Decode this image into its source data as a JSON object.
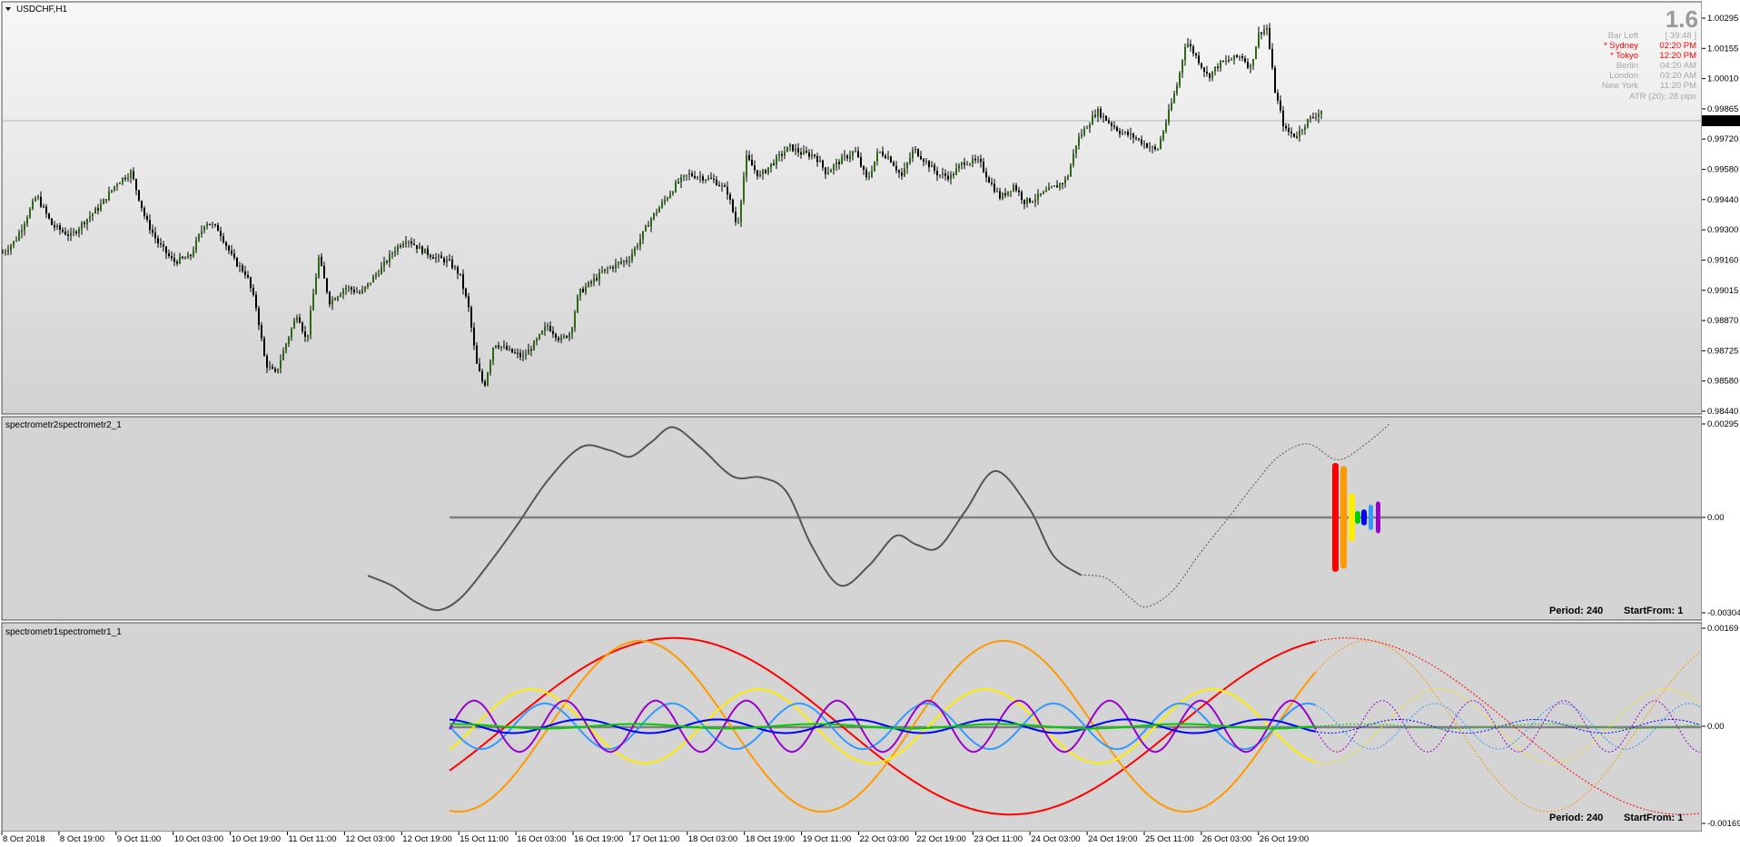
{
  "main_title": "USDCHF,H1",
  "spread_value": "1.6",
  "info_rows": [
    {
      "label": "Bar Left",
      "value": "[ 39:48 ]",
      "color": "#a6a6a6"
    },
    {
      "label": "* Sydney",
      "value": "02:20 PM",
      "color": "#ff0000"
    },
    {
      "label": "* Tokyo",
      "value": "12:20 PM",
      "color": "#ff0000"
    },
    {
      "label": "Berlin",
      "value": "04:20 AM",
      "color": "#a6a6a6"
    },
    {
      "label": "London",
      "value": "03:20 AM",
      "color": "#a6a6a6"
    },
    {
      "label": "New York",
      "value": "11:20 PM",
      "color": "#a6a6a6"
    }
  ],
  "atr_text": "ATR (20): 28 pips",
  "current_price": "0.99805",
  "price_axis_labels": [
    "1.00295",
    "1.00155",
    "1.00010",
    "0.99865",
    "0.99720",
    "0.99580",
    "0.99440",
    "0.99300",
    "0.99160",
    "0.99015",
    "0.98870",
    "0.98725",
    "0.98580",
    "0.98440"
  ],
  "sub1_title": "spectrometr2spectrometr2_1",
  "sub1_axis": [
    "0.00295",
    "0.00",
    "-0.00304"
  ],
  "sub1_footer": {
    "period": "Period: 240",
    "start": "StartFrom: 1"
  },
  "sub2_title": "spectrometr1spectrometr1_1",
  "sub2_axis": [
    "0.00169",
    "0.00",
    "-0.00169"
  ],
  "sub2_footer": {
    "period": "Period: 240",
    "start": "StartFrom: 1"
  },
  "time_labels": [
    "8 Oct 2018",
    "8 Oct 19:00",
    "9 Oct 11:00",
    "10 Oct 03:00",
    "10 Oct 19:00",
    "11 Oct 11:00",
    "12 Oct 03:00",
    "12 Oct 19:00",
    "15 Oct 11:00",
    "16 Oct 03:00",
    "16 Oct 19:00",
    "17 Oct 11:00",
    "18 Oct 03:00",
    "18 Oct 19:00",
    "19 Oct 11:00",
    "22 Oct 03:00",
    "22 Oct 19:00",
    "23 Oct 11:00",
    "24 Oct 03:00",
    "24 Oct 19:00",
    "25 Oct 11:00",
    "26 Oct 03:00",
    "26 Oct 19:00"
  ],
  "colors": {
    "bg_top": "#f7f7f7",
    "bg_bottom": "#d4d4d4",
    "candle_up": "#2a6b12",
    "candle_down": "#000000",
    "spectrum_line": "#555555",
    "zero_line": "#808080"
  },
  "chart_data": [
    {
      "type": "candlestick",
      "title": "USDCHF,H1",
      "ylim": [
        0.9844,
        1.0032
      ],
      "current": 0.99805,
      "close_path": [
        [
          0,
          0.9917
        ],
        [
          14,
          0.9924
        ],
        [
          33,
          0.9945
        ],
        [
          47,
          0.9931
        ],
        [
          64,
          0.9926
        ],
        [
          76,
          0.9933
        ],
        [
          90,
          0.994
        ],
        [
          105,
          0.9951
        ],
        [
          118,
          0.9956
        ],
        [
          131,
          0.9934
        ],
        [
          142,
          0.9923
        ],
        [
          156,
          0.9914
        ],
        [
          171,
          0.9916
        ],
        [
          185,
          0.9933
        ],
        [
          197,
          0.9929
        ],
        [
          210,
          0.9915
        ],
        [
          222,
          0.9908
        ],
        [
          231,
          0.9892
        ],
        [
          239,
          0.9866
        ],
        [
          248,
          0.9861
        ],
        [
          258,
          0.9876
        ],
        [
          268,
          0.989
        ],
        [
          276,
          0.9876
        ],
        [
          287,
          0.9916
        ],
        [
          297,
          0.9895
        ],
        [
          311,
          0.9902
        ],
        [
          325,
          0.9899
        ],
        [
          334,
          0.9905
        ],
        [
          345,
          0.9912
        ],
        [
          356,
          0.992
        ],
        [
          366,
          0.9925
        ],
        [
          378,
          0.992
        ],
        [
          392,
          0.9916
        ],
        [
          404,
          0.9914
        ],
        [
          414,
          0.9908
        ],
        [
          422,
          0.9892
        ],
        [
          429,
          0.9866
        ],
        [
          436,
          0.9855
        ],
        [
          445,
          0.9876
        ],
        [
          458,
          0.9872
        ],
        [
          471,
          0.9869
        ],
        [
          481,
          0.9875
        ],
        [
          493,
          0.9884
        ],
        [
          505,
          0.9877
        ],
        [
          514,
          0.9881
        ],
        [
          521,
          0.9899
        ],
        [
          534,
          0.9905
        ],
        [
          545,
          0.991
        ],
        [
          556,
          0.9913
        ],
        [
          566,
          0.9915
        ],
        [
          577,
          0.9925
        ],
        [
          586,
          0.9934
        ],
        [
          600,
          0.9944
        ],
        [
          610,
          0.9951
        ],
        [
          620,
          0.9955
        ],
        [
          631,
          0.9954
        ],
        [
          644,
          0.9952
        ],
        [
          655,
          0.9947
        ],
        [
          664,
          0.993
        ],
        [
          672,
          0.9963
        ],
        [
          684,
          0.9954
        ],
        [
          695,
          0.996
        ],
        [
          711,
          0.9968
        ],
        [
          722,
          0.9965
        ],
        [
          734,
          0.9964
        ],
        [
          744,
          0.9956
        ],
        [
          758,
          0.9962
        ],
        [
          770,
          0.9966
        ],
        [
          781,
          0.9952
        ],
        [
          791,
          0.9966
        ],
        [
          801,
          0.9963
        ],
        [
          812,
          0.9954
        ],
        [
          823,
          0.9967
        ],
        [
          834,
          0.9961
        ],
        [
          845,
          0.9955
        ],
        [
          856,
          0.9954
        ],
        [
          868,
          0.9961
        ],
        [
          882,
          0.9961
        ],
        [
          891,
          0.9952
        ],
        [
          901,
          0.9944
        ],
        [
          913,
          0.995
        ],
        [
          923,
          0.9942
        ],
        [
          933,
          0.9944
        ],
        [
          943,
          0.9947
        ],
        [
          953,
          0.995
        ],
        [
          961,
          0.9953
        ],
        [
          970,
          0.9971
        ],
        [
          979,
          0.9978
        ],
        [
          988,
          0.9985
        ],
        [
          998,
          0.998
        ],
        [
          1009,
          0.9975
        ],
        [
          1020,
          0.9973
        ],
        [
          1032,
          0.9969
        ],
        [
          1042,
          0.9966
        ],
        [
          1052,
          0.9983
        ],
        [
          1061,
          0.9999
        ],
        [
          1068,
          1.0018
        ],
        [
          1078,
          1.001
        ],
        [
          1088,
          1.0001
        ],
        [
          1098,
          1.0007
        ],
        [
          1108,
          1.0009
        ],
        [
          1118,
          1.0011
        ],
        [
          1126,
          1.0005
        ],
        [
          1134,
          1.0022
        ],
        [
          1141,
          1.0024
        ],
        [
          1148,
          0.9995
        ],
        [
          1157,
          0.9976
        ],
        [
          1167,
          0.9973
        ],
        [
          1177,
          0.998
        ],
        [
          1190,
          0.9985
        ]
      ]
    },
    {
      "type": "line",
      "title": "spectrometr2spectrometr2_1",
      "ylim": [
        -0.00304,
        0.00295
      ],
      "zero": 0.0,
      "series": [
        {
          "values": [
            [
              405,
              -0.00182
            ],
            [
              432,
              -0.00214
            ],
            [
              458,
              -0.00265
            ],
            [
              483,
              -0.0029
            ],
            [
              508,
              -0.0025
            ],
            [
              537,
              -0.0015
            ],
            [
              568,
              -0.0003
            ],
            [
              603,
              0.00115
            ],
            [
              640,
              0.0022
            ],
            [
              671,
              0.0021
            ],
            [
              694,
              0.0019
            ],
            [
              717,
              0.00235
            ],
            [
              741,
              0.00282
            ],
            [
              771,
              0.0022
            ],
            [
              807,
              0.00128
            ],
            [
              838,
              0.00125
            ],
            [
              866,
              0.0008
            ],
            [
              894,
              -0.0009
            ],
            [
              925,
              -0.00213
            ],
            [
              957,
              -0.0015
            ],
            [
              986,
              -0.00058
            ],
            [
              1009,
              -0.00085
            ],
            [
              1033,
              -0.00095
            ],
            [
              1063,
              0.0002
            ],
            [
              1096,
              0.00145
            ],
            [
              1133,
              0.0003
            ],
            [
              1160,
              -0.0012
            ],
            [
              1190,
              -0.0018
            ]
          ]
        },
        {
          "values": [
            [
              1190,
              -0.0018
            ],
            [
              1218,
              -0.0019
            ],
            [
              1244,
              -0.0025
            ],
            [
              1262,
              -0.0028
            ],
            [
              1291,
              -0.0023
            ],
            [
              1322,
              -0.0011
            ],
            [
              1353,
              0.0
            ],
            [
              1383,
              0.0011
            ],
            [
              1408,
              0.0019
            ],
            [
              1440,
              0.0023
            ],
            [
              1473,
              0.0018
            ],
            [
              1504,
              0.0023
            ],
            [
              1531,
              0.00295
            ]
          ]
        }
      ],
      "spectrum_bars": [
        {
          "color": "#ff0000",
          "half_height": 0.0017
        },
        {
          "color": "#ff9900",
          "half_height": 0.0016
        },
        {
          "color": "#ffee00",
          "half_height": 0.00075
        },
        {
          "color": "#00cc00",
          "half_height": 0.0002
        },
        {
          "color": "#0000ff",
          "half_height": 0.00025
        },
        {
          "color": "#3399ff",
          "half_height": 0.0004
        },
        {
          "color": "#9900cc",
          "half_height": 0.0005
        }
      ]
    },
    {
      "type": "line",
      "title": "spectrometr1spectrometr1_1",
      "ylim": [
        -0.00169,
        0.00169
      ],
      "zero": 0.0,
      "series": [
        {
          "color": "#ff0000",
          "amplitude": 0.00155,
          "period_px": 740,
          "phase_px": 742
        },
        {
          "color": "#ff9900",
          "amplitude": 0.0015,
          "period_px": 400,
          "phase_px": 705
        },
        {
          "color": "#ffee00",
          "amplitude": 0.00065,
          "period_px": 250,
          "phase_px": 585
        },
        {
          "color": "#3399ff",
          "amplitude": 0.0004,
          "period_px": 140,
          "phase_px": 460
        },
        {
          "color": "#9900cc",
          "amplitude": 0.00045,
          "period_px": 100,
          "phase_px": 422
        },
        {
          "color": "#0000ff",
          "amplitude": 0.00012,
          "period_px": 150,
          "phase_px": 490
        },
        {
          "color": "#00cc00",
          "amplitude": 4e-05,
          "period_px": 200,
          "phase_px": 500
        }
      ]
    }
  ]
}
